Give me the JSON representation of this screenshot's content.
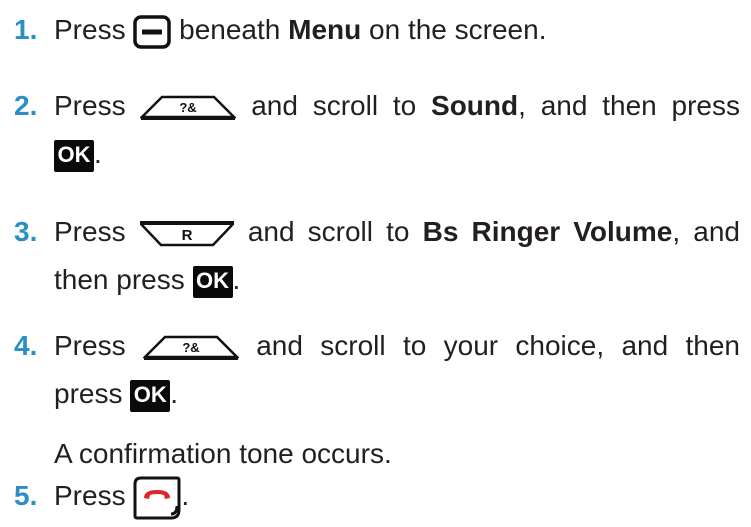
{
  "steps": [
    {
      "number": "1.",
      "line1": {
        "before": "Press ",
        "icon": "menu-softkey-icon",
        "mid": " beneath ",
        "bold": "Menu",
        "after": " on the screen."
      }
    },
    {
      "number": "2.",
      "line1": {
        "before": "Press ",
        "icon": "up-navigation-key-icon",
        "mid": " and scroll to ",
        "bold": "Sound",
        "after": ", and then press"
      },
      "line2": {
        "key": "OK",
        "after": "."
      }
    },
    {
      "number": "3.",
      "line1": {
        "before": "Press ",
        "icon": "down-recall-key-icon",
        "mid": " and scroll to ",
        "bold": "Bs Ringer Volume",
        "after": ", and"
      },
      "line2": {
        "before": "then press ",
        "key": "OK",
        "after": "."
      }
    },
    {
      "number": "4.",
      "line1": {
        "before": "Press ",
        "icon": "up-navigation-key-icon",
        "after": " and scroll to your choice, and then"
      },
      "line2": {
        "before": "press ",
        "key": "OK",
        "after": "."
      },
      "note": "A confirmation tone occurs."
    },
    {
      "number": "5.",
      "line1": {
        "before": "Press ",
        "icon": "end-call-key-icon",
        "after": "."
      }
    }
  ],
  "colors": {
    "step_number": "#2a8fc6",
    "text": "#231f20",
    "ok_key_bg": "#0a0a0a",
    "end_call_red": "#e0242a"
  },
  "icon_labels": {
    "up_key_glyph": "?&",
    "down_key_glyph": "R"
  }
}
